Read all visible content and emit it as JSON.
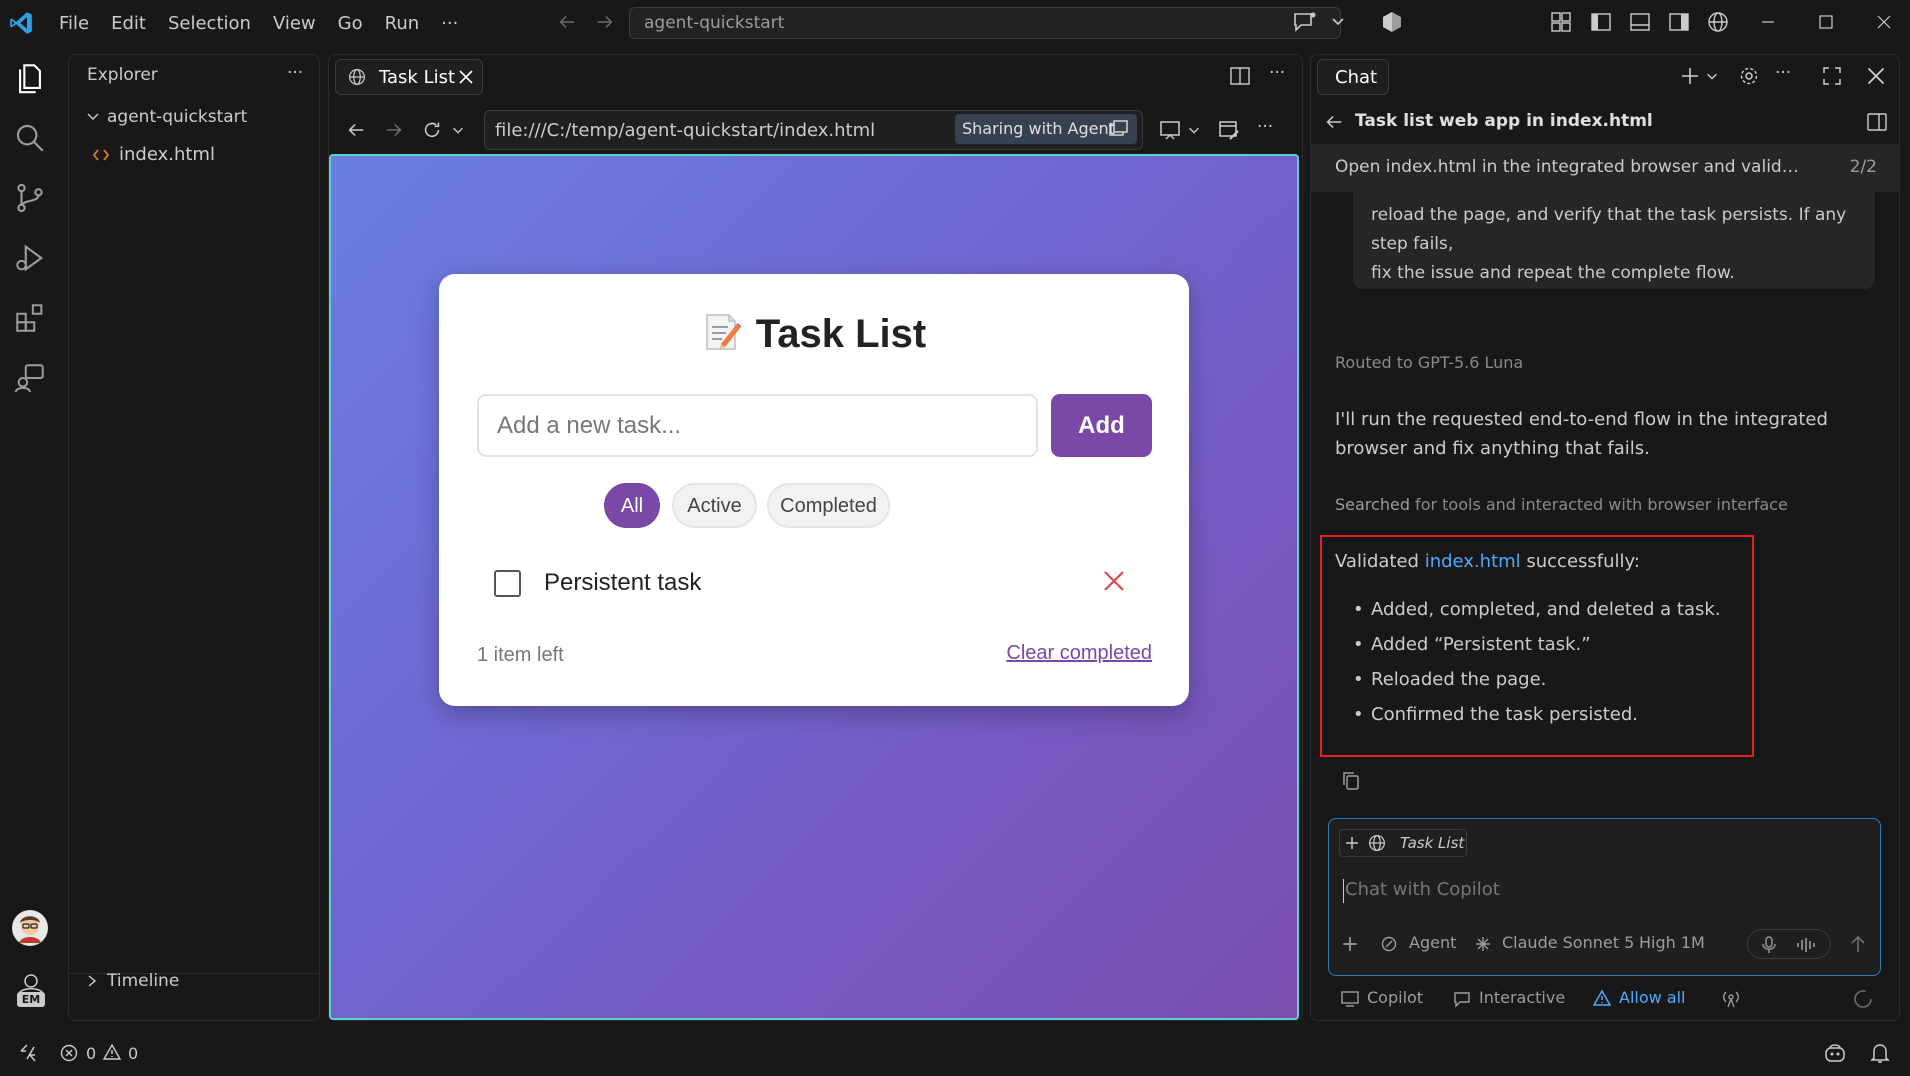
{
  "titlebar": {
    "menu": [
      "File",
      "Edit",
      "Selection",
      "View",
      "Go",
      "Run",
      "···"
    ],
    "search_text": "agent-quickstart"
  },
  "sidebar": {
    "title": "Explorer",
    "more": "···",
    "folder": "agent-quickstart",
    "file": "index.html",
    "timeline": "Timeline"
  },
  "activity": {
    "account_initials": "EM"
  },
  "editor": {
    "tab_label": "Task List",
    "url": "file:///C:/temp/agent-quickstart/index.html",
    "sharing_badge": "Sharing with Agent",
    "more": "···"
  },
  "app": {
    "title": "Task List",
    "input_placeholder": "Add a new task...",
    "add_label": "Add",
    "filters": [
      "All",
      "Active",
      "Completed"
    ],
    "active_filter": "All",
    "tasks": [
      {
        "text": "Persistent task",
        "completed": false
      }
    ],
    "items_left": "1 item left",
    "clear_label": "Clear completed"
  },
  "chat": {
    "tab_label": "Chat",
    "more": "···",
    "session_title": "Task list web app in index.html",
    "request_banner": "Open index.html in the integrated browser and validate the app",
    "request_counter": "2/2",
    "user_message": "reload the page, and verify that the task persists. If any step fails,\nfix the issue and repeat the complete flow.",
    "routed": "Routed to GPT-5.6 Luna",
    "response": "I'll run the requested end-to-end flow in the integrated browser and fix anything that fails.",
    "searched_prefix": "Searched",
    "searched_rest": " for tools and interacted with browser interface",
    "validated_prefix": "Validated ",
    "validated_link": "index.html",
    "validated_suffix": " successfully:",
    "bullets": [
      "Added, completed, and deleted a task.",
      "Added “Persistent task.”",
      "Reloaded the page.",
      "Confirmed the task persisted."
    ],
    "context_chip": "Task List",
    "input_placeholder": "Chat with Copilot",
    "mode": "Agent",
    "model": "Claude Sonnet 5",
    "effort": "High 1M",
    "status": {
      "copilot": "Copilot",
      "interactive": "Interactive",
      "allow_all": "Allow all"
    }
  },
  "statusbar": {
    "errors": "0",
    "warnings": "0"
  },
  "colors": {
    "accent": "#7a49a8",
    "link": "#4daafc",
    "highlight_border": "#e0241f",
    "delete_x": "#e04848"
  }
}
